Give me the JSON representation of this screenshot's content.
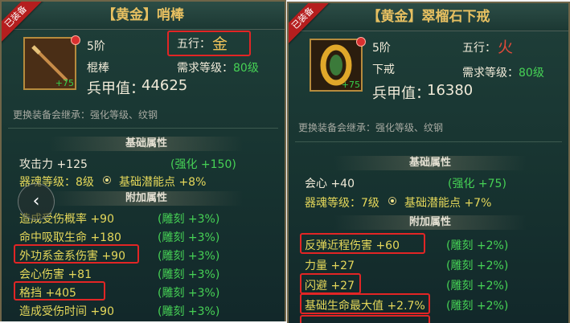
{
  "left": {
    "badge": "已装备",
    "title": "【黄金】哨棒",
    "tier": "5阶",
    "type": "棍棒",
    "element_label": "五行：",
    "element_char": "金",
    "req_label": "需求等级：",
    "req_value": "80级",
    "level_badge": "+75",
    "power_label": "兵甲值：",
    "power_value": "44625",
    "note": "更换装备会继承：强化等级、纹钢",
    "base_header": "基础属性",
    "base_stats": [
      {
        "name": "攻击力 +125",
        "bonus": "(强化 +150)"
      }
    ],
    "soul": {
      "text": "器魂等级：8级",
      "extra": "基础潜能点 +8%"
    },
    "extra_header": "附加属性",
    "extra_stats": [
      {
        "name": "造成受伤概率  +90",
        "bonus": "(雕刻 +3%)"
      },
      {
        "name": "命中吸取生命  +180",
        "bonus": "(雕刻 +3%)"
      },
      {
        "name": "外功系金系伤害  +90",
        "bonus": "(雕刻 +3%)"
      },
      {
        "name": "会心伤害  +81",
        "bonus": "(雕刻 +3%)"
      },
      {
        "name": "格挡  +405",
        "bonus": "(雕刻 +3%)"
      },
      {
        "name": "造成受伤时间  +90",
        "bonus": "(雕刻 +3%)"
      }
    ],
    "nav_arrow": "‹"
  },
  "right": {
    "badge": "已装备",
    "title": "【黄金】翠榴石下戒",
    "tier": "5阶",
    "type": "下戒",
    "element_label": "五行：",
    "element_char": "火",
    "req_label": "需求等级：",
    "req_value": "80级",
    "level_badge": "+75",
    "power_label": "兵甲值：",
    "power_value": "16380",
    "note": "更换装备会继承：强化等级、纹钢",
    "base_header": "基础属性",
    "base_stats": [
      {
        "name": "会心 +40",
        "bonus": "(强化 +75)"
      }
    ],
    "soul": {
      "text": "器魂等级：7级",
      "extra": "基础潜能点 +7%"
    },
    "extra_header": "附加属性",
    "extra_stats": [
      {
        "name": "反弹近程伤害  +60",
        "bonus": "(雕刻 +2%)"
      },
      {
        "name": "力量  +27",
        "bonus": "(雕刻 +2%)"
      },
      {
        "name": "闪避  +27",
        "bonus": "(雕刻 +2%)"
      },
      {
        "name": "基础生命最大值  +2.7%",
        "bonus": "(雕刻 +2%)"
      }
    ]
  }
}
